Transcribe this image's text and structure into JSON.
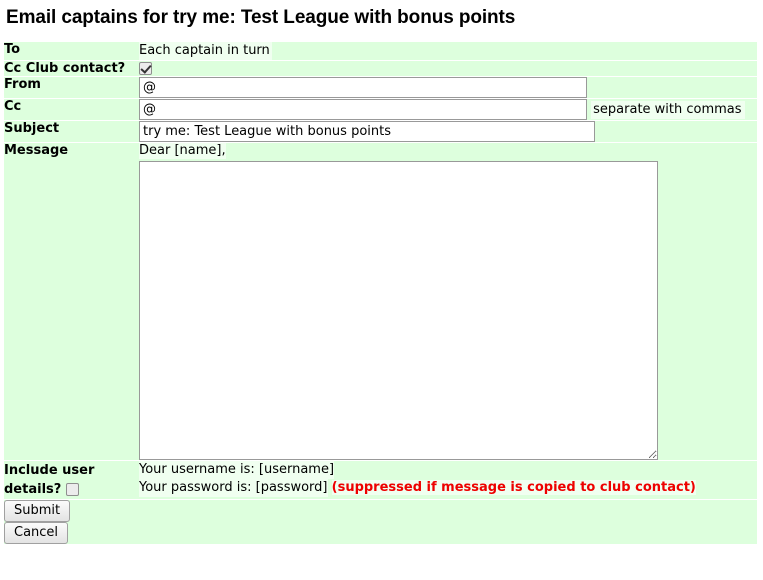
{
  "page": {
    "title": "Email captains for try me: Test League with bonus points"
  },
  "form": {
    "to": {
      "label": "To",
      "value": "Each captain in turn"
    },
    "cc_club_contact": {
      "label": "Cc Club contact?",
      "checked": true
    },
    "from": {
      "label": "From",
      "value": "@",
      "placeholder": ""
    },
    "cc": {
      "label": "Cc",
      "value": "@",
      "placeholder": "",
      "hint": "separate with commas"
    },
    "subject": {
      "label": "Subject",
      "value": "try me: Test League with bonus points",
      "placeholder": ""
    },
    "message": {
      "label": "Message",
      "greeting": "Dear [name],",
      "body": "",
      "placeholder": ""
    },
    "include_user_details": {
      "label_line1": "Include user",
      "label_line2": "details?",
      "checked": false,
      "username_line": "Your username is: [username]",
      "password_line": "Your password is: [password]",
      "warning": "(suppressed if message is copied to club contact)"
    }
  },
  "actions": {
    "submit_label": "Submit",
    "cancel_label": "Cancel"
  },
  "colors": {
    "label_bg": "#a0ffa0",
    "cell_bg": "#ddffdd",
    "inner_bg": "#f0fff0",
    "warning": "#ee0000"
  }
}
